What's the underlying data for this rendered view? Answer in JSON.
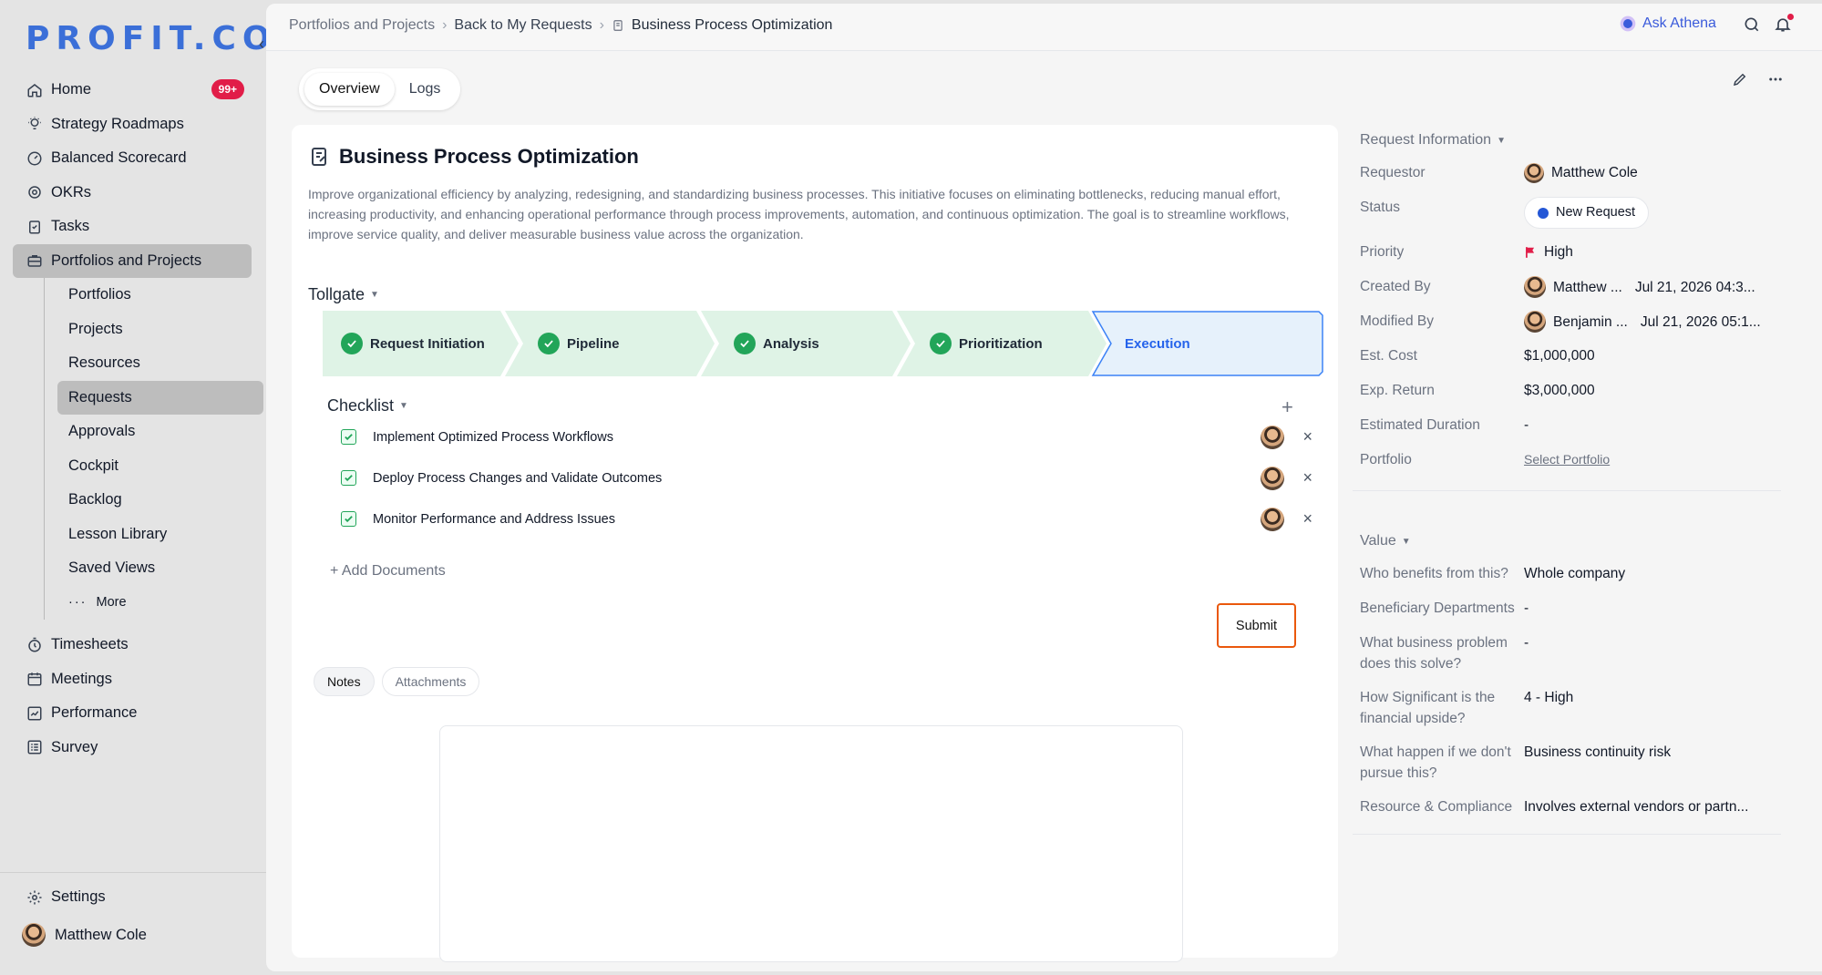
{
  "sidebar": {
    "logo": "PROFIT.CO",
    "nav": [
      {
        "label": "Home",
        "badge": "99+"
      },
      {
        "label": "Strategy Roadmaps"
      },
      {
        "label": "Balanced Scorecard"
      },
      {
        "label": "OKRs"
      },
      {
        "label": "Tasks"
      },
      {
        "label": "Portfolios and Projects"
      }
    ],
    "sub": [
      "Portfolios",
      "Projects",
      "Resources",
      "Requests",
      "Approvals",
      "Cockpit",
      "Backlog",
      "Lesson Library",
      "Saved Views",
      "More"
    ],
    "nav2": [
      "Timesheets",
      "Meetings",
      "Performance",
      "Survey"
    ],
    "settings": "Settings",
    "user": "Matthew Cole"
  },
  "breadcrumb": [
    "Portfolios and Projects",
    "Back to My Requests",
    "Business Process Optimization"
  ],
  "header": {
    "ask": "Ask Athena"
  },
  "tabs": [
    "Overview",
    "Logs"
  ],
  "request": {
    "title": "Business Process Optimization",
    "description": "Improve organizational efficiency by analyzing, redesigning, and standardizing business processes. This initiative focuses on eliminating bottlenecks, reducing manual effort, increasing productivity, and enhancing operational performance through process improvements, automation, and continuous optimization. The goal is to streamline workflows, improve service quality, and deliver measurable business value across the organization."
  },
  "tollgate": {
    "label": "Tollgate",
    "stages": [
      "Request Initiation",
      "Pipeline",
      "Analysis",
      "Prioritization",
      "Execution"
    ]
  },
  "checklist": {
    "label": "Checklist",
    "items": [
      "Implement Optimized Process Workflows",
      "Deploy Process Changes and Validate Outcomes",
      "Monitor Performance and Address Issues"
    ]
  },
  "add_documents": "Add Documents",
  "submit": "Submit",
  "subtabs": [
    "Notes",
    "Attachments"
  ],
  "info": {
    "header": "Request Information",
    "rows": [
      {
        "label": "Requestor",
        "value": "Matthew Cole"
      },
      {
        "label": "Status",
        "value": "New Request"
      },
      {
        "label": "Priority",
        "value": "High"
      },
      {
        "label": "Created By",
        "value": "Matthew ...",
        "date": "Jul 21, 2026 04:3..."
      },
      {
        "label": "Modified By",
        "value": "Benjamin ...",
        "date": "Jul 21, 2026 05:1..."
      },
      {
        "label": "Est. Cost",
        "value": "$1,000,000"
      },
      {
        "label": "Exp. Return",
        "value": "$3,000,000"
      },
      {
        "label": "Estimated Duration",
        "value": "-"
      },
      {
        "label": "Portfolio",
        "value": "Select Portfolio"
      }
    ]
  },
  "value": {
    "header": "Value",
    "rows": [
      {
        "label": "Who benefits from this?",
        "value": "Whole company"
      },
      {
        "label": "Beneficiary Departments",
        "value": "-"
      },
      {
        "label": "What business problem does this solve?",
        "value": "-"
      },
      {
        "label": "How Significant is the financial upside?",
        "value": "4 - High"
      },
      {
        "label": "What happen if we don't pursue this?",
        "value": "Business continuity risk"
      },
      {
        "label": "Resource & Compliance",
        "value": "Involves external vendors or partn..."
      }
    ]
  },
  "colors": {
    "accent": "#3b6fd8",
    "success": "#22a559",
    "stage_done": "#dff3e6",
    "stage_active": "#e6f1fb",
    "submit_border": "#ea580c"
  }
}
